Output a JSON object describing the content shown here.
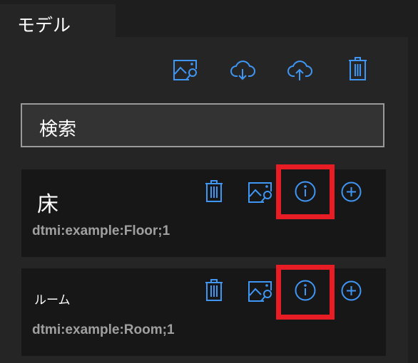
{
  "tab": {
    "label": "モデル"
  },
  "toolbar": {
    "icons": [
      "image-search-icon",
      "cloud-download-icon",
      "cloud-upload-icon",
      "trash-icon"
    ]
  },
  "search": {
    "placeholder": "検索"
  },
  "models": [
    {
      "name": "床",
      "id": "dtmi:example:Floor;1"
    },
    {
      "name": "ルーム",
      "id": "dtmi:example:Room;1"
    }
  ],
  "colors": {
    "accent": "#3f96f5",
    "highlight": "#e81c24"
  }
}
